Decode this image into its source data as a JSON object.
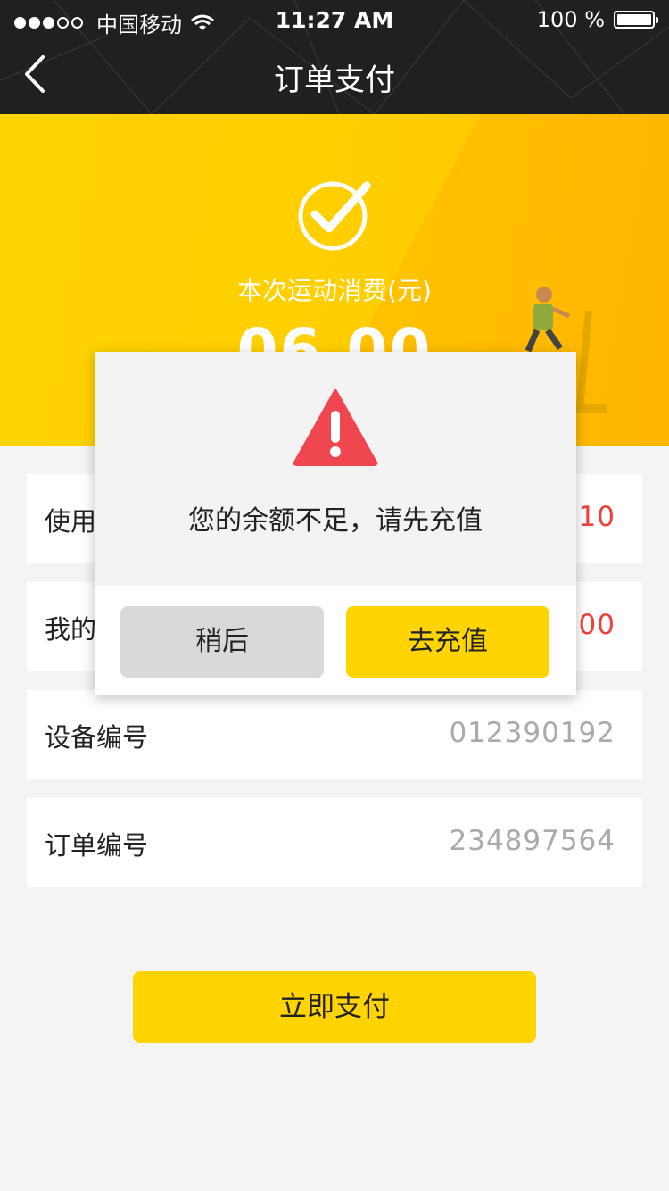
{
  "status_bar": {
    "carrier": "中国移动",
    "time": "11:27 AM",
    "battery": "100 %"
  },
  "nav": {
    "title": "订单支付"
  },
  "hero": {
    "caption": "本次运动消费(元)",
    "amount": "06.00"
  },
  "rows": [
    {
      "label": "使用",
      "value": ":10"
    },
    {
      "label": "我的",
      "value": ".00"
    },
    {
      "label": "设备编号",
      "value": "012390192"
    },
    {
      "label": "订单编号",
      "value": "234897564"
    }
  ],
  "pay_button": "立即支付",
  "dialog": {
    "message": "您的余额不足，请先充值",
    "later_label": "稍后",
    "recharge_label": "去充值"
  },
  "colors": {
    "accent": "#ffd400",
    "warning": "#f04650",
    "alert_text": "#f0403c"
  }
}
